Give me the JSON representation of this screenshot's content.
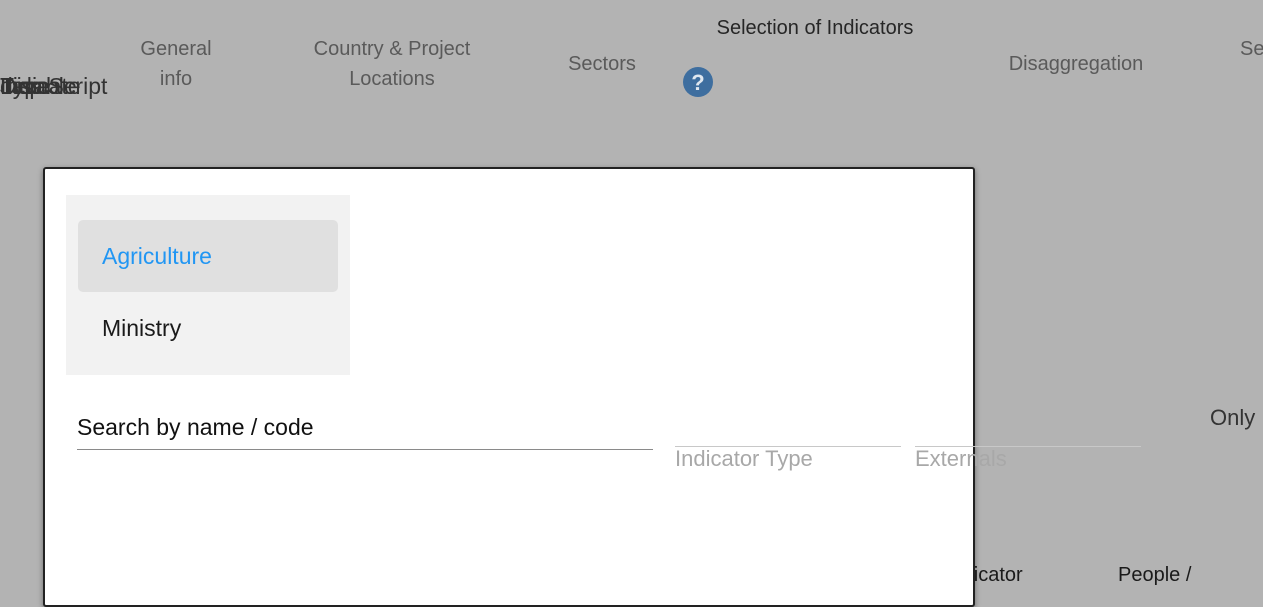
{
  "background": {
    "overlapping_texts": [
      "Type",
      "Disable",
      "JavaScript",
      "Indicate",
      "disp"
    ],
    "steps": [
      {
        "line1": "General",
        "line2": "info"
      },
      {
        "line1": "Country & Project",
        "line2": "Locations"
      },
      {
        "line1": "Sectors",
        "line2": ""
      },
      {
        "line1": "Selection of Indicators",
        "line2": ""
      },
      {
        "line1": "Disaggregation",
        "line2": ""
      },
      {
        "line1": "Se",
        "line2": ""
      }
    ],
    "help_icon_glyph": "?",
    "only_label": "Only",
    "column_headers": [
      "Indicator",
      "People /"
    ]
  },
  "modal": {
    "sectors": [
      "Agriculture",
      "Ministry"
    ],
    "selected_sector": "Agriculture",
    "search": {
      "placeholder": "Search by name / code",
      "value": ""
    },
    "indicator_type_label": "Indicator Type",
    "externals_label": "Externals"
  },
  "colors": {
    "backdrop": "#b3b3b3",
    "accent": "#2196f3",
    "help_icon": "#3e6e9f"
  }
}
